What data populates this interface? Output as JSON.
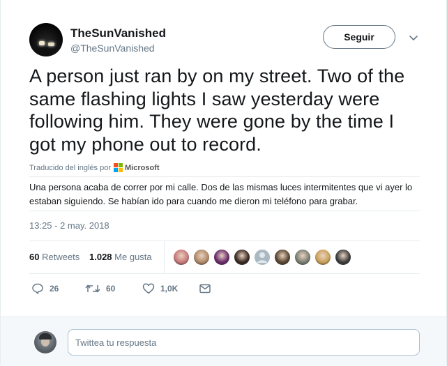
{
  "user": {
    "display_name": "TheSunVanished",
    "handle": "@TheSunVanished",
    "follow_label": "Seguir"
  },
  "tweet": {
    "text": "A person just ran by on my street. Two of the same flashing lights I saw yesterday were following him. They were gone by the time I got my phone out to record.",
    "translated_by_label": "Traducido del inglés por",
    "translator": "Microsoft",
    "translation": "Una persona acaba de correr por mi calle. Dos de las mismas luces intermitentes que vi ayer lo estaban siguiendo. Se habían ido para cuando me dieron mi teléfono para grabar.",
    "timestamp": "13:25 - 2 may. 2018"
  },
  "stats": {
    "retweets_count": "60",
    "retweets_label": "Retweets",
    "likes_count": "1.028",
    "likes_label": "Me gusta"
  },
  "likers": [
    {
      "icon": "liker-avatar",
      "color": "#c77a7a"
    },
    {
      "icon": "liker-avatar",
      "color": "#b08a6a"
    },
    {
      "icon": "liker-avatar",
      "color": "#6a2c6e"
    },
    {
      "icon": "liker-avatar",
      "color": "#3a2a22"
    },
    {
      "icon": "default-avatar",
      "color": "#aab8c2"
    },
    {
      "icon": "liker-avatar",
      "color": "#5a4632"
    },
    {
      "icon": "liker-avatar",
      "color": "#7c7f74"
    },
    {
      "icon": "liker-avatar",
      "color": "#caa15a"
    },
    {
      "icon": "liker-avatar",
      "color": "#3c3c3c"
    }
  ],
  "actions": {
    "reply_count": "26",
    "retweet_count": "60",
    "like_count": "1,0K"
  },
  "reply": {
    "placeholder": "Twittea tu respuesta"
  },
  "colors": {
    "text_primary": "#14171a",
    "text_secondary": "#657786",
    "border": "#e6ecf0",
    "reply_bg": "#f5f8fa"
  }
}
